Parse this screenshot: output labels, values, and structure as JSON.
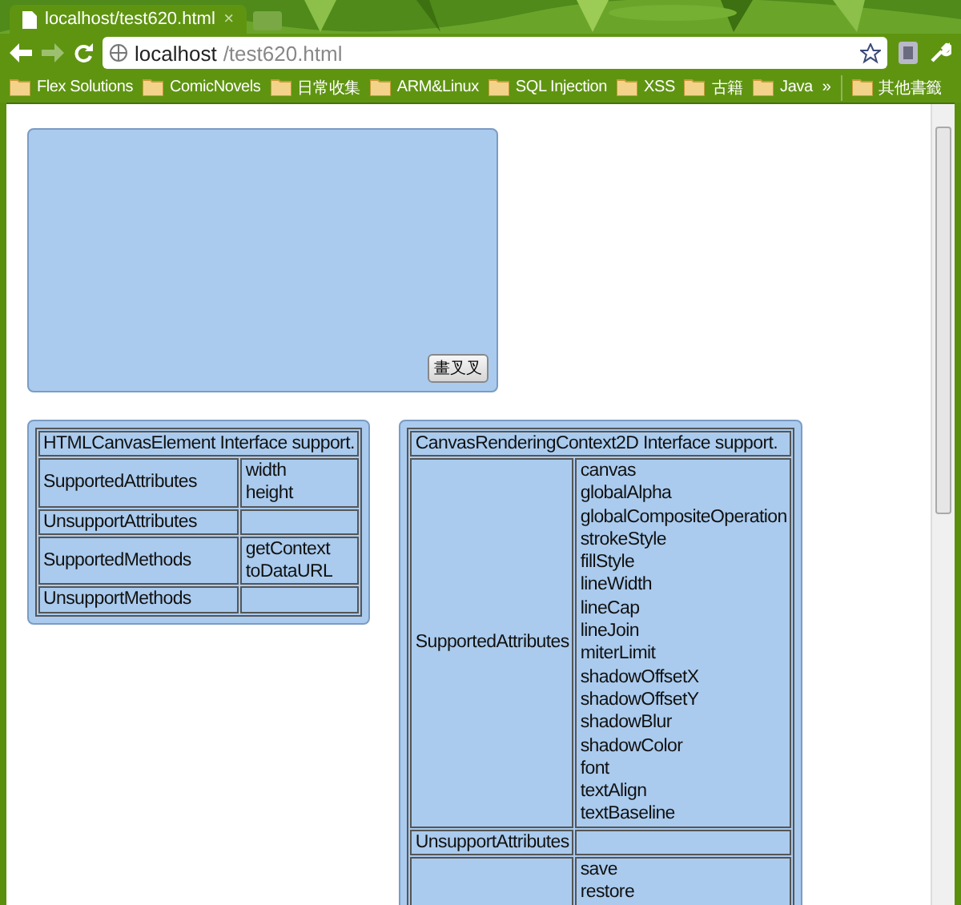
{
  "tab": {
    "title": "localhost/test620.html",
    "close": "×",
    "selected": true
  },
  "address": {
    "host": "localhost",
    "path": "/test620.html"
  },
  "bookmarks": [
    {
      "label": "Flex Solutions"
    },
    {
      "label": "ComicNovels"
    },
    {
      "label": "日常收集"
    },
    {
      "label": "ARM&Linux"
    },
    {
      "label": "SQL Injection"
    },
    {
      "label": "XSS"
    },
    {
      "label": "古籍"
    },
    {
      "label": "Java"
    }
  ],
  "bookmarks_more": "»",
  "other_bookmarks": "其他書籤",
  "canvas_panel": {
    "button": "畫叉叉"
  },
  "tables": [
    {
      "caption": "HTMLCanvasElement Interface support.",
      "rows": [
        {
          "label": "SupportedAttributes",
          "items": [
            "width",
            "height"
          ]
        },
        {
          "label": "UnsupportAttributes",
          "items": []
        },
        {
          "label": "SupportedMethods",
          "items": [
            "getContext",
            "toDataURL"
          ]
        },
        {
          "label": "UnsupportMethods",
          "items": []
        }
      ]
    },
    {
      "caption": "CanvasRenderingContext2D Interface support.",
      "rows": [
        {
          "label": "SupportedAttributes",
          "items": [
            "canvas",
            "globalAlpha",
            "globalCompositeOperation",
            "strokeStyle",
            "fillStyle",
            "lineWidth",
            "lineCap",
            "lineJoin",
            "miterLimit",
            "shadowOffsetX",
            "shadowOffsetY",
            "shadowBlur",
            "shadowColor",
            "font",
            "textAlign",
            "textBaseline"
          ]
        },
        {
          "label": "UnsupportAttributes",
          "items": []
        },
        {
          "items": [
            "save",
            "restore"
          ]
        }
      ]
    }
  ]
}
